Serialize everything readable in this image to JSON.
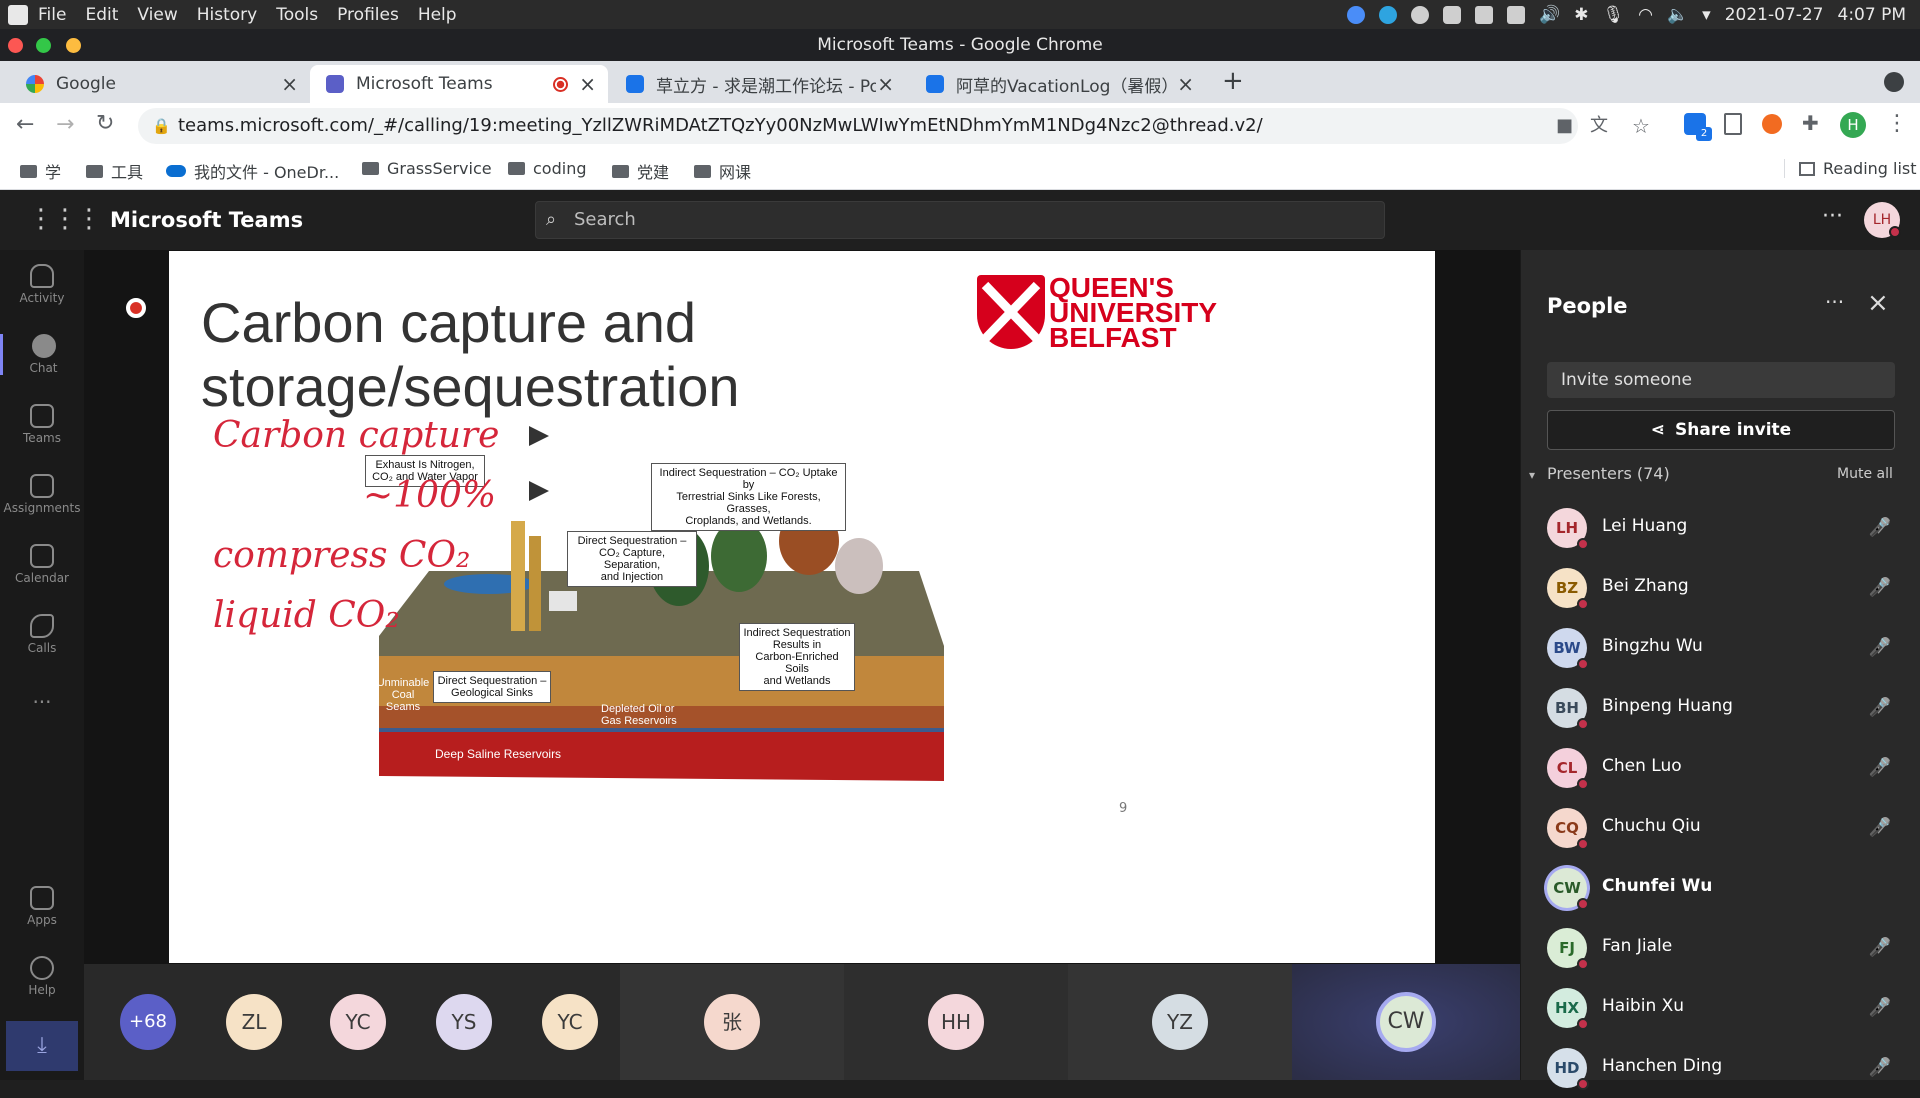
{
  "os": {
    "menu": [
      "File",
      "Edit",
      "View",
      "History",
      "Tools",
      "Profiles",
      "Help"
    ],
    "date": "2021-07-27",
    "time": "4:07 PM"
  },
  "window": {
    "title": "Microsoft Teams - Google Chrome"
  },
  "tabs": [
    {
      "label": "Google"
    },
    {
      "label": "Microsoft Teams"
    },
    {
      "label": "草立方 - 求是潮工作论坛 - Pow"
    },
    {
      "label": "阿草的VacationLog（暑假）"
    }
  ],
  "address": {
    "url": "teams.microsoft.com/_#/calling/19:meeting_YzllZWRiMDAtZTQzYy00NzMwLWIwYmEtNDhmYmM1NDg4Nzc2@thread.v2/",
    "extension_badge": "2",
    "profile_initial": "H"
  },
  "bookmarks": [
    "学",
    "工具",
    "我的文件 - OneDr...",
    "GrassService",
    "coding",
    "党建",
    "网课"
  ],
  "reading_list": "Reading list",
  "teams": {
    "app_name": "Microsoft Teams",
    "search_placeholder": "Search",
    "user_initials": "LH",
    "rail": [
      "Activity",
      "Chat",
      "Teams",
      "Assignments",
      "Calendar",
      "Calls",
      "Apps",
      "Help"
    ]
  },
  "slide": {
    "title_line1": "Carbon capture and",
    "title_line2": "storage/sequestration",
    "logo_line1": "QUEEN'S",
    "logo_line2": "UNIVERSITY",
    "logo_line3": "BELFAST",
    "page_number": "9",
    "labels": {
      "exhaust_line1": "Exhaust Is Nitrogen,",
      "exhaust_line2": "CO₂ and Water Vapor",
      "indirect_top_line1": "Indirect Sequestration – CO₂ Uptake by",
      "indirect_top_line2": "Terrestrial Sinks Like Forests, Grasses,",
      "indirect_top_line3": "Croplands, and Wetlands.",
      "direct_top_line1": "Direct Sequestration –",
      "direct_top_line2": "CO₂ Capture, Separation,",
      "direct_top_line3": "and Injection",
      "indirect_soil_line1": "Indirect Sequestration",
      "indirect_soil_line2": "Results in",
      "indirect_soil_line3": "Carbon-Enriched Soils",
      "indirect_soil_line4": "and Wetlands",
      "direct_geo_line1": "Direct Sequestration –",
      "direct_geo_line2": "Geological Sinks",
      "coal_line1": "Unminable",
      "coal_line2": "Coal",
      "coal_line3": "Seams",
      "oil_line1": "Depleted Oil or",
      "oil_line2": "Gas Reservoirs",
      "saline": "Deep Saline Reservoirs"
    },
    "handwriting": {
      "line1": "Carbon capture",
      "line2": "~100%",
      "line3": "compress CO₂",
      "line4": "liquid CO₂"
    }
  },
  "strip": {
    "more_count": "+68",
    "avatars": [
      "ZL",
      "YC",
      "YS",
      "YC",
      "张",
      "HH",
      "YZ",
      "CW"
    ]
  },
  "people": {
    "title": "People",
    "invite_placeholder": "Invite someone",
    "share_label": "Share invite",
    "presenters_label": "Presenters (74)",
    "mute_all": "Mute all",
    "list": [
      {
        "initials": "LH",
        "name": "Lei Huang",
        "color": "#f4d7dc"
      },
      {
        "initials": "BZ",
        "name": "Bei Zhang",
        "color": "#f6e2c6"
      },
      {
        "initials": "BW",
        "name": "Bingzhu Wu",
        "color": "#cfd9ee"
      },
      {
        "initials": "BH",
        "name": "Binpeng Huang",
        "color": "#d5dde3"
      },
      {
        "initials": "CL",
        "name": "Chen Luo",
        "color": "#f4d0dc"
      },
      {
        "initials": "CQ",
        "name": "Chuchu Qiu",
        "color": "#f5d8cd"
      },
      {
        "initials": "CW",
        "name": "Chunfei Wu",
        "color": "#dce9d6"
      },
      {
        "initials": "FJ",
        "name": "Fan Jiale",
        "color": "#daedd6"
      },
      {
        "initials": "HX",
        "name": "Haibin Xu",
        "color": "#d3ecdf"
      },
      {
        "initials": "HD",
        "name": "Hanchen Ding",
        "color": "#d6e0ea"
      }
    ]
  }
}
